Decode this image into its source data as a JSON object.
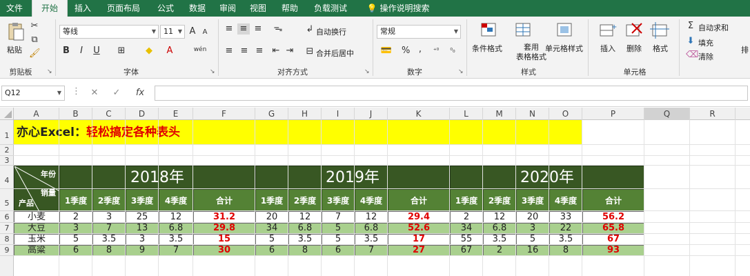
{
  "ribbon_tabs": [
    "文件",
    "开始",
    "插入",
    "页面布局",
    "公式",
    "数据",
    "审阅",
    "视图",
    "帮助",
    "负载测试",
    "操作说明搜索"
  ],
  "active_tab": "开始",
  "clipboard": {
    "paste": "粘贴",
    "label": "剪贴板"
  },
  "font": {
    "name": "等线",
    "size": "11",
    "bold": "B",
    "italic": "I",
    "underline": "U",
    "label": "字体",
    "grow": "A",
    "shrink": "A",
    "wen": "wén"
  },
  "alignment": {
    "wrap": "自动换行",
    "merge": "合并后居中",
    "label": "对齐方式"
  },
  "number": {
    "format": "常规",
    "percent": "%",
    "comma": ",",
    "label": "数字"
  },
  "styles": {
    "conditional": "条件格式",
    "table": "套用\n表格格式",
    "cell": "单元格样式",
    "label": "样式"
  },
  "cells": {
    "insert": "插入",
    "delete": "删除",
    "format": "格式",
    "label": "单元格"
  },
  "editing": {
    "autosum": "自动求和",
    "fill": "填充",
    "clear": "清除",
    "sort": "排"
  },
  "formula_bar": {
    "name_box": "Q12",
    "fx": "fx"
  },
  "columns": [
    "A",
    "B",
    "C",
    "D",
    "E",
    "F",
    "G",
    "H",
    "I",
    "J",
    "K",
    "L",
    "M",
    "N",
    "O",
    "P",
    "Q",
    "R"
  ],
  "selected_column": "Q",
  "rows": [
    "1",
    "2",
    "3",
    "4",
    "5",
    "6",
    "7",
    "8",
    "9"
  ],
  "sheet": {
    "title_black": "亦心Excel：",
    "title_red": "轻松搞定各种表头",
    "header_year_label": "年份",
    "header_metric_label": "销量",
    "header_product_label": "产品",
    "years": [
      "2018年",
      "2019年",
      "2020年"
    ],
    "quarters": [
      "1季度",
      "2季度",
      "3季度",
      "4季度",
      "合计"
    ],
    "data": [
      {
        "product": "小麦",
        "values": [
          "2",
          "3",
          "25",
          "12",
          "31.2",
          "20",
          "12",
          "7",
          "12",
          "29.4",
          "2",
          "12",
          "20",
          "33",
          "56.2"
        ]
      },
      {
        "product": "大豆",
        "values": [
          "3",
          "7",
          "13",
          "6.8",
          "29.8",
          "34",
          "6.8",
          "5",
          "6.8",
          "52.6",
          "34",
          "6.8",
          "3",
          "22",
          "65.8"
        ]
      },
      {
        "product": "玉米",
        "values": [
          "5",
          "3.5",
          "3",
          "3.5",
          "15",
          "5",
          "3.5",
          "5",
          "3.5",
          "17",
          "55",
          "3.5",
          "5",
          "3.5",
          "67"
        ]
      },
      {
        "product": "高粱",
        "values": [
          "6",
          "8",
          "9",
          "7",
          "30",
          "6",
          "8",
          "6",
          "7",
          "27",
          "67",
          "2",
          "16",
          "8",
          "93"
        ]
      }
    ]
  }
}
